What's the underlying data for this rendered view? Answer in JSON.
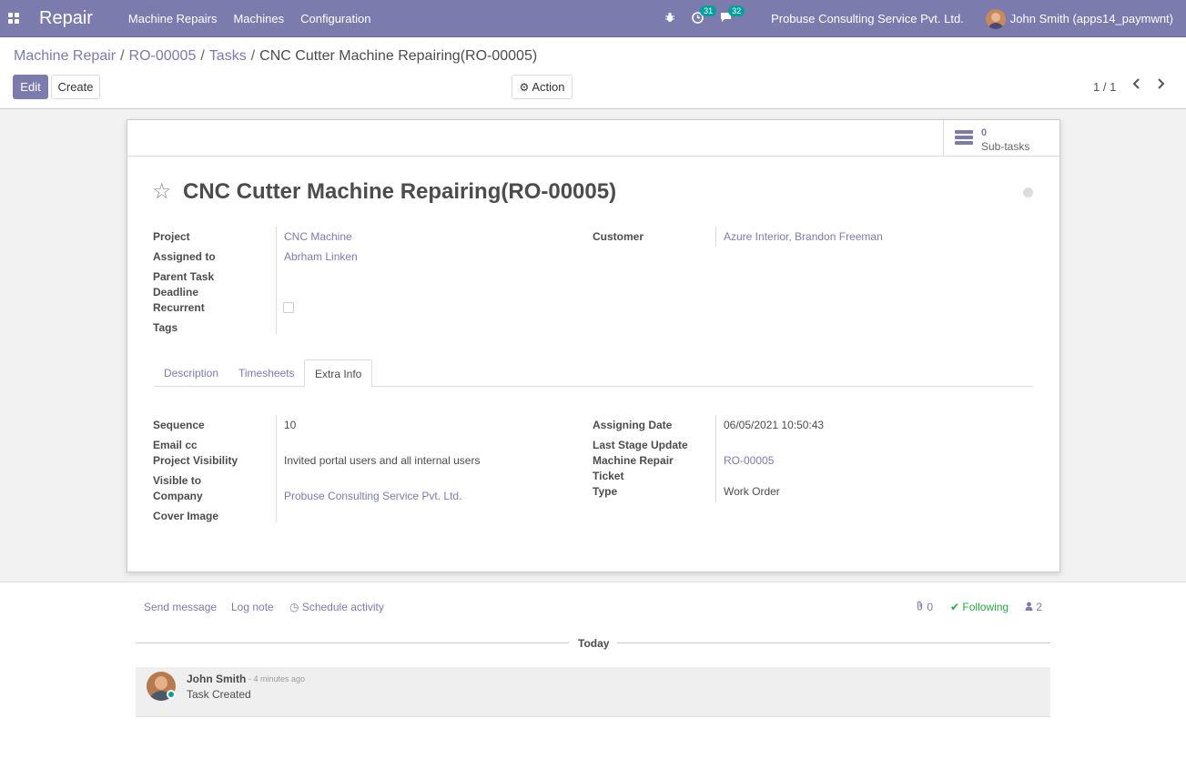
{
  "navbar": {
    "brand": "Repair",
    "menu": [
      "Machine Repairs",
      "Machines",
      "Configuration"
    ],
    "activity_count": "31",
    "messages_count": "32",
    "company": "Probuse Consulting Service Pvt. Ltd.",
    "user": "John Smith (apps14_paymwnt)",
    "bg_color": "#7c7bad"
  },
  "breadcrumb": {
    "items": [
      "Machine Repair",
      "RO-00005",
      "Tasks"
    ],
    "current": "CNC Cutter Machine Repairing(RO-00005)"
  },
  "toolbar": {
    "edit": "Edit",
    "create": "Create",
    "action": "Action",
    "pager": "1 / 1"
  },
  "buttonbox": {
    "subtasks_count": "0",
    "subtasks_label": "Sub-tasks"
  },
  "record": {
    "title": "CNC Cutter Machine Repairing(RO-00005)",
    "fields_left": [
      {
        "label": "Project",
        "value": "CNC Machine"
      },
      {
        "label": "Assigned to",
        "value": "Abrham Linken"
      },
      {
        "label": "Parent Task",
        "value": ""
      },
      {
        "label": "Deadline",
        "value": ""
      },
      {
        "label": "Recurrent",
        "value": ""
      },
      {
        "label": "Tags",
        "value": ""
      }
    ],
    "fields_right": [
      {
        "label": "Customer",
        "value": "Azure Interior, Brandon Freeman"
      }
    ]
  },
  "tabs": [
    "Description",
    "Timesheets",
    "Extra Info"
  ],
  "extra_info": {
    "left": [
      {
        "label": "Sequence",
        "value": "10"
      },
      {
        "label": "Email cc",
        "value": ""
      },
      {
        "label": "Project Visibility",
        "value": "Invited portal users and all internal users"
      },
      {
        "label": "Visible to",
        "value": ""
      },
      {
        "label": "Company",
        "value": "Probuse Consulting Service Pvt. Ltd."
      },
      {
        "label": "Cover Image",
        "value": ""
      }
    ],
    "right": [
      {
        "label": "Assigning Date",
        "value": "06/05/2021 10:50:43"
      },
      {
        "label": "Last Stage Update",
        "value": ""
      },
      {
        "label": "Machine Repair",
        "value": "RO-00005"
      },
      {
        "label": "Ticket",
        "value": ""
      },
      {
        "label": "Type",
        "value": "Work Order"
      }
    ]
  },
  "chatter": {
    "send_message": "Send message",
    "log_note": "Log note",
    "schedule_activity": "Schedule activity",
    "attachments": "0",
    "following": "Following",
    "followers": "2",
    "today": "Today",
    "message": {
      "author": "John Smith",
      "time": "- 4 minutes ago",
      "body": "Task Created"
    }
  }
}
